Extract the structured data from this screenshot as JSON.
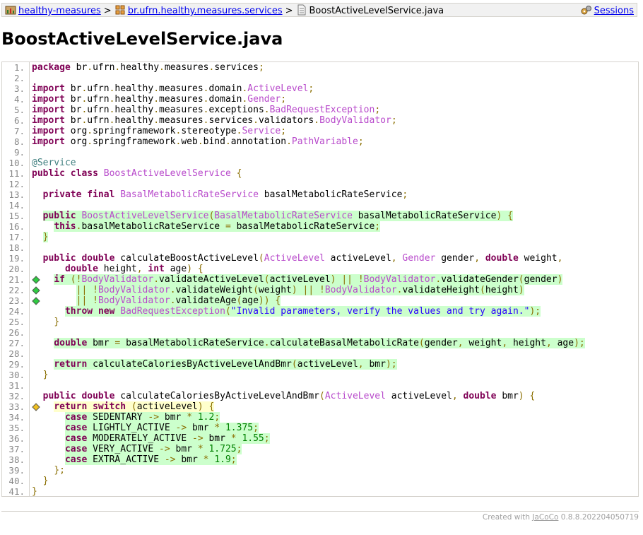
{
  "breadcrumb": {
    "items": [
      "healthy-measures",
      "br.ufrn.healthy.measures.services",
      "BoostActiveLevelService.java"
    ],
    "separator": ">"
  },
  "sessions_label": "Sessions",
  "page_title": "BoostActiveLevelService.java",
  "footer": {
    "prefix": "Created with",
    "link": "JaCoCo",
    "version": "0.8.8.202204050719"
  },
  "colors": {
    "fully_covered": "#ccffcc",
    "partly_covered": "#ffffcc",
    "branch_full": "#2ecc40",
    "branch_partial": "#f0c020"
  },
  "source": [
    {
      "n": "1.",
      "c": "n",
      "t": "package br.ufrn.healthy.measures.services;"
    },
    {
      "n": "2.",
      "c": "n",
      "t": ""
    },
    {
      "n": "3.",
      "c": "n",
      "t": "import br.ufrn.healthy.measures.domain.ActiveLevel;"
    },
    {
      "n": "4.",
      "c": "n",
      "t": "import br.ufrn.healthy.measures.domain.Gender;"
    },
    {
      "n": "5.",
      "c": "n",
      "t": "import br.ufrn.healthy.measures.exceptions.BadRequestException;"
    },
    {
      "n": "6.",
      "c": "n",
      "t": "import br.ufrn.healthy.measures.services.validators.BodyValidator;"
    },
    {
      "n": "7.",
      "c": "n",
      "t": "import org.springframework.stereotype.Service;"
    },
    {
      "n": "8.",
      "c": "n",
      "t": "import org.springframework.web.bind.annotation.PathVariable;"
    },
    {
      "n": "9.",
      "c": "n",
      "t": ""
    },
    {
      "n": "10.",
      "c": "n",
      "t": "@Service"
    },
    {
      "n": "11.",
      "c": "n",
      "t": "public class BoostActiveLevelService {"
    },
    {
      "n": "12.",
      "c": "n",
      "t": ""
    },
    {
      "n": "13.",
      "c": "n",
      "t": "  private final BasalMetabolicRateService basalMetabolicRateService;"
    },
    {
      "n": "14.",
      "c": "n",
      "t": ""
    },
    {
      "n": "15.",
      "c": "fc",
      "t": "  public BoostActiveLevelService(BasalMetabolicRateService basalMetabolicRateService) {"
    },
    {
      "n": "16.",
      "c": "fc",
      "t": "    this.basalMetabolicRateService = basalMetabolicRateService;"
    },
    {
      "n": "17.",
      "c": "fc",
      "t": "  }"
    },
    {
      "n": "18.",
      "c": "n",
      "t": ""
    },
    {
      "n": "19.",
      "c": "n",
      "t": "  public double calculateBoostActiveLevel(ActiveLevel activeLevel, Gender gender, double weight,"
    },
    {
      "n": "20.",
      "c": "n",
      "t": "      double height, int age) {"
    },
    {
      "n": "21.",
      "c": "fc",
      "b": "g",
      "t": "    if (!BodyValidator.validateActiveLevel(activeLevel) || !BodyValidator.validateGender(gender)"
    },
    {
      "n": "22.",
      "c": "fc",
      "b": "g",
      "t": "        || !BodyValidator.validateWeight(weight) || !BodyValidator.validateHeight(height)"
    },
    {
      "n": "23.",
      "c": "fc",
      "b": "g",
      "t": "        || !BodyValidator.validateAge(age)) {"
    },
    {
      "n": "24.",
      "c": "fc",
      "t": "      throw new BadRequestException(\"Invalid parameters, verify the values and try again.\");"
    },
    {
      "n": "25.",
      "c": "n",
      "t": "    }"
    },
    {
      "n": "26.",
      "c": "n",
      "t": ""
    },
    {
      "n": "27.",
      "c": "fc",
      "t": "    double bmr = basalMetabolicRateService.calculateBasalMetabolicRate(gender, weight, height, age);"
    },
    {
      "n": "28.",
      "c": "n",
      "t": ""
    },
    {
      "n": "29.",
      "c": "fc",
      "t": "    return calculateCaloriesByActiveLevelAndBmr(activeLevel, bmr);"
    },
    {
      "n": "30.",
      "c": "n",
      "t": "  }"
    },
    {
      "n": "31.",
      "c": "n",
      "t": ""
    },
    {
      "n": "32.",
      "c": "n",
      "t": "  public double calculateCaloriesByActiveLevelAndBmr(ActiveLevel activeLevel, double bmr) {"
    },
    {
      "n": "33.",
      "c": "pc",
      "b": "y",
      "t": "    return switch (activeLevel) {"
    },
    {
      "n": "34.",
      "c": "fc",
      "t": "      case SEDENTARY -> bmr * 1.2;"
    },
    {
      "n": "35.",
      "c": "fc",
      "t": "      case LIGHTLY_ACTIVE -> bmr * 1.375;"
    },
    {
      "n": "36.",
      "c": "fc",
      "t": "      case MODERATELY_ACTIVE -> bmr * 1.55;"
    },
    {
      "n": "37.",
      "c": "fc",
      "t": "      case VERY_ACTIVE -> bmr * 1.725;"
    },
    {
      "n": "38.",
      "c": "fc",
      "t": "      case EXTRA_ACTIVE -> bmr * 1.9;"
    },
    {
      "n": "39.",
      "c": "n",
      "t": "    };"
    },
    {
      "n": "40.",
      "c": "n",
      "t": "  }"
    },
    {
      "n": "41.",
      "c": "n",
      "t": "}"
    }
  ]
}
